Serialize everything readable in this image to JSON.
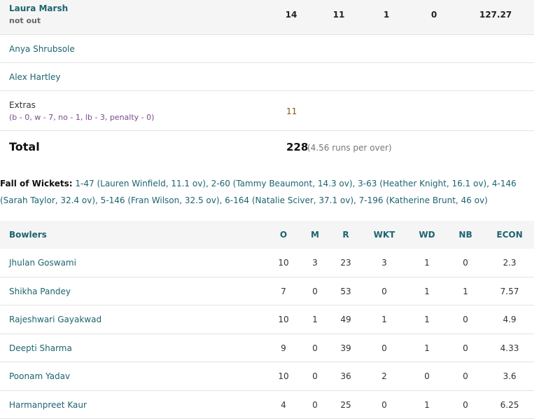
{
  "batting": {
    "not_out": {
      "name": "Laura Marsh",
      "dismissal": "not out",
      "stats": [
        "14",
        "11",
        "1",
        "0",
        "127.27"
      ]
    },
    "dnb": [
      "Anya Shrubsole",
      "Alex Hartley"
    ],
    "extras": {
      "label": "Extras",
      "detail": "(b - 0, w - 7, no - 1, lb - 3, penalty - 0)",
      "value": "11"
    },
    "total": {
      "label": "Total",
      "value": "228",
      "rate": "(4.56 runs per over)"
    }
  },
  "fall_of_wickets": {
    "label": "Fall of Wickets:",
    "text": "1-47 (Lauren Winfield, 11.1 ov), 2-60 (Tammy Beaumont, 14.3 ov), 3-63 (Heather Knight, 16.1 ov), 4-146 (Sarah Taylor, 32.4 ov), 5-146 (Fran Wilson, 32.5 ov), 6-164 (Natalie Sciver, 37.1 ov), 7-196 (Katherine Brunt, 46 ov)"
  },
  "bowling": {
    "headers": [
      "Bowlers",
      "O",
      "M",
      "R",
      "WKT",
      "WD",
      "NB",
      "ECON"
    ],
    "rows": [
      [
        "Jhulan Goswami",
        "10",
        "3",
        "23",
        "3",
        "1",
        "0",
        "2.3"
      ],
      [
        "Shikha Pandey",
        "7",
        "0",
        "53",
        "0",
        "1",
        "1",
        "7.57"
      ],
      [
        "Rajeshwari Gayakwad",
        "10",
        "1",
        "49",
        "1",
        "1",
        "0",
        "4.9"
      ],
      [
        "Deepti Sharma",
        "9",
        "0",
        "39",
        "0",
        "1",
        "0",
        "4.33"
      ],
      [
        "Poonam Yadav",
        "10",
        "0",
        "36",
        "2",
        "0",
        "0",
        "3.6"
      ],
      [
        "Harmanpreet Kaur",
        "4",
        "0",
        "25",
        "0",
        "1",
        "0",
        "6.25"
      ]
    ]
  }
}
